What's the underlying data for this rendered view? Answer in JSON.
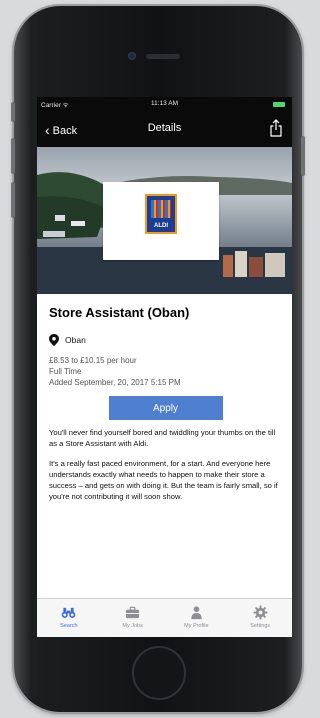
{
  "status_bar": {
    "carrier": "Carrier ᯤ",
    "time": "11:13 AM"
  },
  "nav": {
    "back_label": "Back",
    "title": "Details"
  },
  "brand": {
    "logo_text": "ALDI"
  },
  "job": {
    "title": "Store Assistant (Oban)",
    "location": "Oban",
    "pay": "£8.53 to £10.15 per hour",
    "hours": "Full Time",
    "added": "Added September, 20, 2017 5:15 PM",
    "apply_label": "Apply",
    "description": [
      "You'll never find yourself bored and twiddling your thumbs on the till as a Store Assistant with Aldi.",
      "It's a really fast paced environment, for a start. And everyone here understands exactly what needs to happen to make their store a success – and gets on with doing it. But the team is fairly small, so if you're not contributing it will soon show."
    ]
  },
  "tabs": [
    {
      "label": "Search",
      "icon": "binoculars-icon",
      "active": true
    },
    {
      "label": "My Jobs",
      "icon": "briefcase-icon",
      "active": false
    },
    {
      "label": "My Profile",
      "icon": "person-icon",
      "active": false
    },
    {
      "label": "Settings",
      "icon": "gear-icon",
      "active": false
    }
  ],
  "colors": {
    "accent": "#4e7fd0",
    "tab_active": "#3b6fd6",
    "header": "#0a0a0a"
  }
}
